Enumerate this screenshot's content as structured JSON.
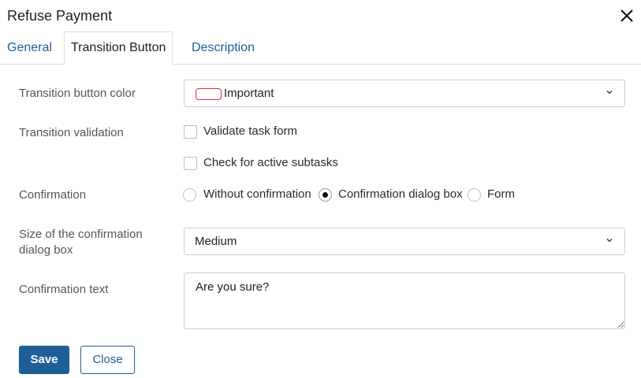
{
  "dialog": {
    "title": "Refuse Payment"
  },
  "icons": {
    "close": "close-icon",
    "chevron": "chevron-down-icon"
  },
  "tabs": [
    {
      "label": "General",
      "active": false
    },
    {
      "label": "Transition Button",
      "active": true
    },
    {
      "label": "Description",
      "active": false
    }
  ],
  "form": {
    "button_color": {
      "label": "Transition button color",
      "value": "Important",
      "swatch_color": "#d9303a"
    },
    "validation": {
      "label": "Transition validation",
      "options": [
        {
          "label": "Validate task form",
          "checked": false
        },
        {
          "label": "Check for active subtasks",
          "checked": false
        }
      ]
    },
    "confirmation": {
      "label": "Confirmation",
      "options": [
        {
          "label": "Without confirmation",
          "selected": false
        },
        {
          "label": "Confirmation dialog box",
          "selected": true
        },
        {
          "label": "Form",
          "selected": false
        }
      ]
    },
    "dialog_size": {
      "label_line1": "Size of the confirmation",
      "label_line2": "dialog box",
      "value": "Medium"
    },
    "confirmation_text": {
      "label": "Confirmation text",
      "value": "Are you sure?"
    }
  },
  "footer": {
    "save_label": "Save",
    "close_label": "Close"
  },
  "colors": {
    "accent": "#1f5f99",
    "swatch_border": "#d9303a"
  }
}
